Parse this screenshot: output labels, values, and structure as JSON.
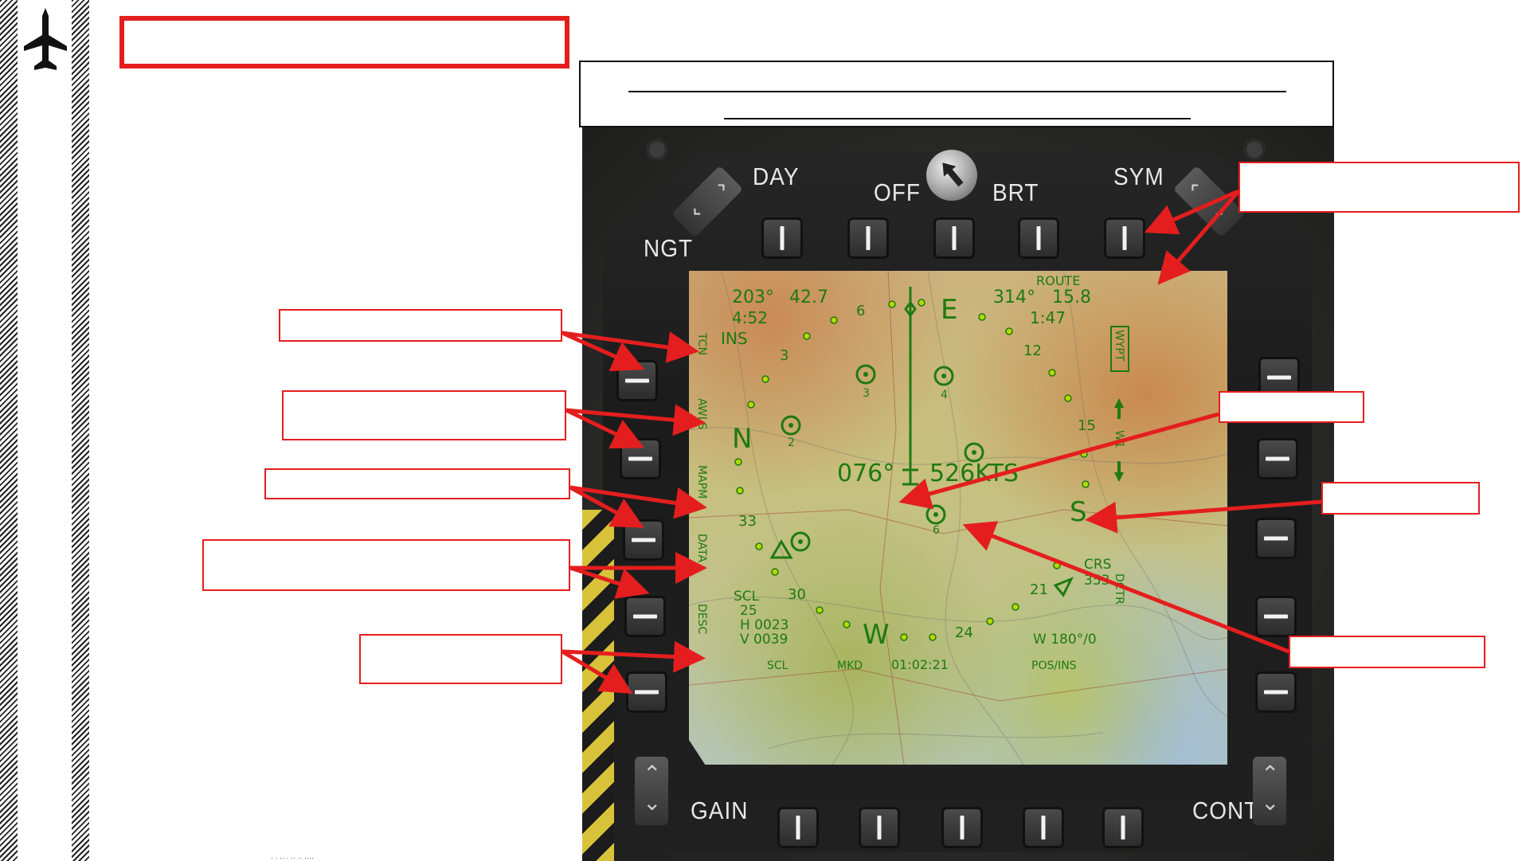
{
  "colors": {
    "accent": "#e41e1e",
    "symbology": "#1f7a10",
    "hatch": "#222222"
  },
  "sidebar": {
    "icon": "aircraft-icon"
  },
  "mfd": {
    "top_labels": {
      "day": "DAY",
      "off": "OFF",
      "brt": "BRT",
      "sym": "SYM",
      "ngt": "NGT"
    },
    "bottom_labels": {
      "gain": "GAIN",
      "cont": "CONT"
    },
    "left_options": [
      "TCN",
      "AWLS",
      "MAPM",
      "DATA",
      "DESC"
    ],
    "right_options": [
      "WYPT",
      "W1",
      "DCTR"
    ],
    "screen": {
      "route": "ROUTE",
      "brg_left": "203°",
      "dist_left": "42.7",
      "time_left": "4:52",
      "brg_right": "314°",
      "dist_right": "15.8",
      "time_right": "1:47",
      "heading_top": "E",
      "cardinal_n": "N",
      "cardinal_s": "S",
      "cardinal_w": "W",
      "nav_source": "INS",
      "tick_6": "6",
      "tick_3": "3",
      "tick_12": "12",
      "tick_15": "15",
      "tick_33": "33",
      "tick_30": "30",
      "tick_24": "24",
      "tick_21": "21",
      "wp_1": "2",
      "wp_2": "3",
      "wp_3": "4",
      "wp_4": "6",
      "track": "076°",
      "ground_speed": "526KTS",
      "crs_label": "CRS",
      "crs_value": "353",
      "scl_label": "SCL",
      "scl_value": "25",
      "h_line": "H 0023",
      "v_line": "V 0039",
      "wind": "W 180°/0",
      "bottom_scl": "SCL",
      "bottom_mkd": "MKD",
      "clock": "01:02:21",
      "pos_ins": "POS/INS"
    }
  },
  "footer_note": "·  · ·· · ·· ·· ····"
}
